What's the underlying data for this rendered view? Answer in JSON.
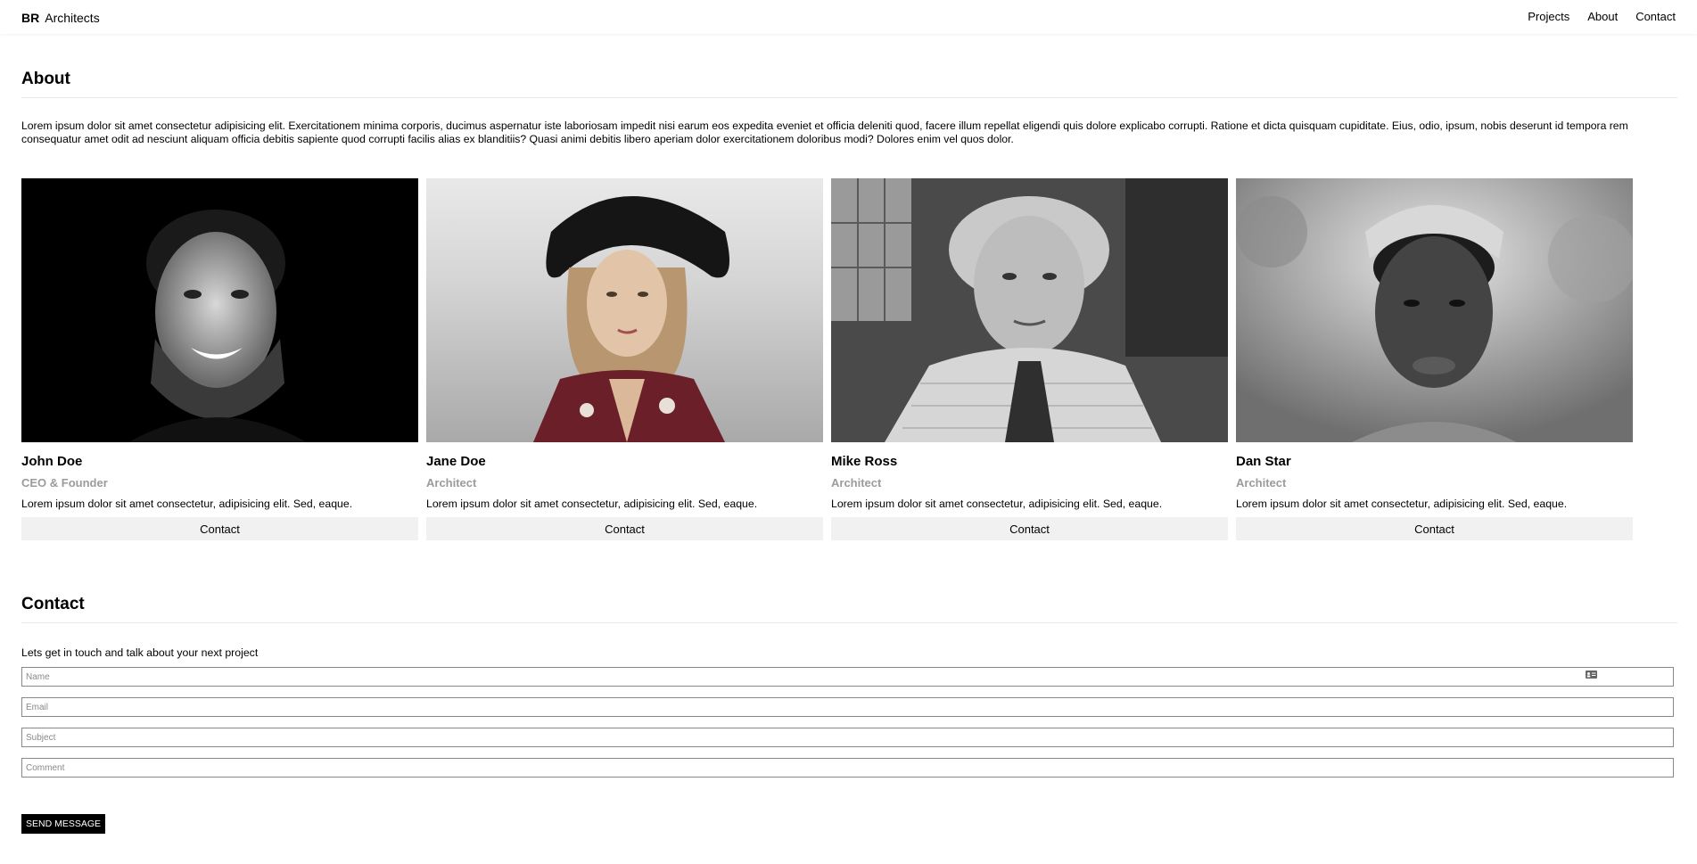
{
  "header": {
    "brand_bold": "BR",
    "brand_rest": "Architects",
    "nav": [
      "Projects",
      "About",
      "Contact"
    ]
  },
  "about": {
    "title": "About",
    "text": "Lorem ipsum dolor sit amet consectetur adipisicing elit. Exercitationem minima corporis, ducimus aspernatur iste laboriosam impedit nisi earum eos expedita eveniet et officia deleniti quod, facere illum repellat eligendi quis dolore explicabo corrupti. Ratione et dicta quisquam cupiditate. Eius, odio, ipsum, nobis deserunt id tempora rem consequatur amet odit ad nesciunt aliquam officia debitis sapiente quod corrupti facilis alias ex blanditiis? Quasi animi debitis libero aperiam dolor exercitationem doloribus modi? Dolores enim vel quos dolor."
  },
  "team": [
    {
      "name": "John Doe",
      "role": "CEO & Founder",
      "desc": "Lorem ipsum dolor sit amet consectetur, adipisicing elit. Sed, eaque.",
      "button": "Contact"
    },
    {
      "name": "Jane Doe",
      "role": "Architect",
      "desc": "Lorem ipsum dolor sit amet consectetur, adipisicing elit. Sed, eaque.",
      "button": "Contact"
    },
    {
      "name": "Mike Ross",
      "role": "Architect",
      "desc": "Lorem ipsum dolor sit amet consectetur, adipisicing elit. Sed, eaque.",
      "button": "Contact"
    },
    {
      "name": "Dan Star",
      "role": "Architect",
      "desc": "Lorem ipsum dolor sit amet consectetur, adipisicing elit. Sed, eaque.",
      "button": "Contact"
    }
  ],
  "contact": {
    "title": "Contact",
    "subtitle": "Lets get in touch and talk about your next project",
    "fields": {
      "name_placeholder": "Name",
      "email_placeholder": "Email",
      "subject_placeholder": "Subject",
      "comment_placeholder": "Comment"
    },
    "send_label": "SEND MESSAGE"
  },
  "colors": {
    "accent": "#000000",
    "muted_text": "#9b9b9b",
    "button_bg": "#f1f1f1"
  }
}
